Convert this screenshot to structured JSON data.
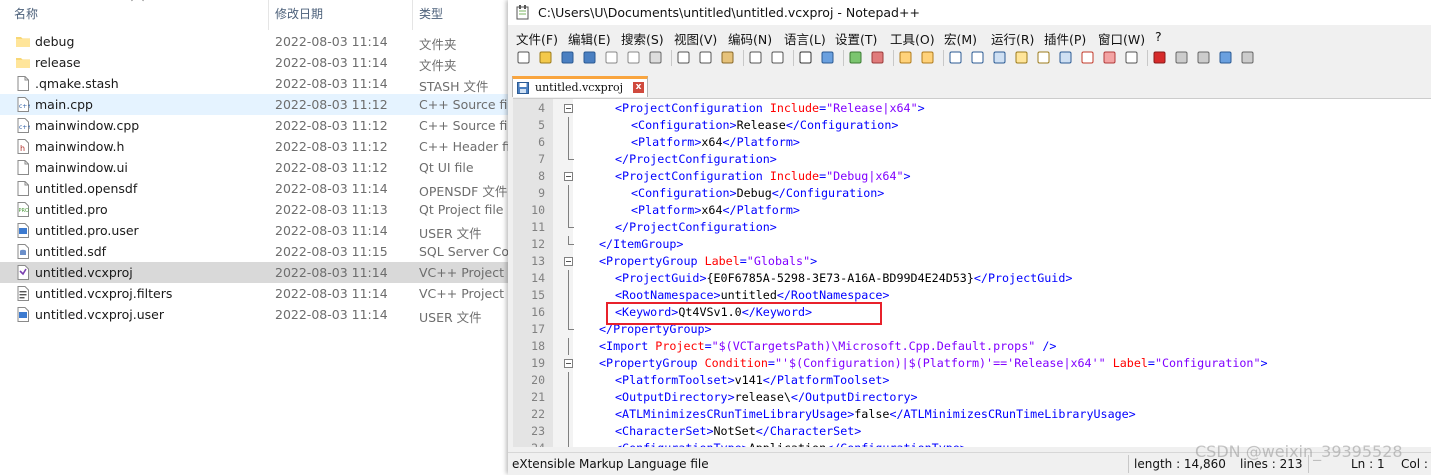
{
  "explorer": {
    "headers": {
      "name": "名称",
      "date": "修改日期",
      "type": "类型"
    },
    "files": [
      {
        "name": "debug",
        "date": "2022-08-03 11:14",
        "type": "文件夹",
        "icon": "folder-icon"
      },
      {
        "name": "release",
        "date": "2022-08-03 11:14",
        "type": "文件夹",
        "icon": "folder-icon"
      },
      {
        "name": ".qmake.stash",
        "date": "2022-08-03 11:14",
        "type": "STASH 文件",
        "icon": "file-icon"
      },
      {
        "name": "main.cpp",
        "date": "2022-08-03 11:12",
        "type": "C++ Source file",
        "icon": "cpp-file-icon"
      },
      {
        "name": "mainwindow.cpp",
        "date": "2022-08-03 11:12",
        "type": "C++ Source file",
        "icon": "cpp-file-icon"
      },
      {
        "name": "mainwindow.h",
        "date": "2022-08-03 11:12",
        "type": "C++ Header file",
        "icon": "header-file-icon"
      },
      {
        "name": "mainwindow.ui",
        "date": "2022-08-03 11:12",
        "type": "Qt UI file",
        "icon": "file-icon"
      },
      {
        "name": "untitled.opensdf",
        "date": "2022-08-03 11:14",
        "type": "OPENSDF 文件",
        "icon": "file-icon"
      },
      {
        "name": "untitled.pro",
        "date": "2022-08-03 11:13",
        "type": "Qt Project file",
        "icon": "pro-file-icon"
      },
      {
        "name": "untitled.pro.user",
        "date": "2022-08-03 11:14",
        "type": "USER 文件",
        "icon": "user-file-icon"
      },
      {
        "name": "untitled.sdf",
        "date": "2022-08-03 11:15",
        "type": "SQL Server Con",
        "icon": "database-file-icon"
      },
      {
        "name": "untitled.vcxproj",
        "date": "2022-08-03 11:14",
        "type": "VC++ Project",
        "icon": "vcxproj-file-icon"
      },
      {
        "name": "untitled.vcxproj.filters",
        "date": "2022-08-03 11:14",
        "type": "VC++ Project Fi",
        "icon": "filters-file-icon"
      },
      {
        "name": "untitled.vcxproj.user",
        "date": "2022-08-03 11:14",
        "type": "USER 文件",
        "icon": "user-file-icon"
      }
    ],
    "hovered_index": 3,
    "selected_index": 11
  },
  "npp": {
    "title": "C:\\Users\\U\\Documents\\untitled\\untitled.vcxproj - Notepad++",
    "menu": [
      "文件(F)",
      "编辑(E)",
      "搜索(S)",
      "视图(V)",
      "编码(N)",
      "语言(L)",
      "设置(T)",
      "工具(O)",
      "宏(M)",
      "运行(R)",
      "插件(P)",
      "窗口(W)",
      "?"
    ],
    "tab": {
      "label": "untitled.vcxproj",
      "close": "x"
    },
    "code_lines": [
      {
        "n": "4",
        "fold": "box",
        "indent": 2,
        "parts": [
          [
            "tag",
            "<ProjectConfiguration "
          ],
          [
            "attr",
            "Include"
          ],
          [
            "tag",
            "="
          ],
          [
            "val",
            "\"Release|x64\""
          ],
          [
            "tag",
            ">"
          ]
        ]
      },
      {
        "n": "5",
        "fold": "line",
        "indent": 3,
        "parts": [
          [
            "tag",
            "<Configuration>"
          ],
          [
            "txt",
            "Release"
          ],
          [
            "tag",
            "</Configuration>"
          ]
        ]
      },
      {
        "n": "6",
        "fold": "line",
        "indent": 3,
        "parts": [
          [
            "tag",
            "<Platform>"
          ],
          [
            "txt",
            "x64"
          ],
          [
            "tag",
            "</Platform>"
          ]
        ]
      },
      {
        "n": "7",
        "fold": "end",
        "indent": 2,
        "parts": [
          [
            "tag",
            "</ProjectConfiguration>"
          ]
        ]
      },
      {
        "n": "8",
        "fold": "box",
        "indent": 2,
        "parts": [
          [
            "tag",
            "<ProjectConfiguration "
          ],
          [
            "attr",
            "Include"
          ],
          [
            "tag",
            "="
          ],
          [
            "val",
            "\"Debug|x64\""
          ],
          [
            "tag",
            ">"
          ]
        ]
      },
      {
        "n": "9",
        "fold": "line",
        "indent": 3,
        "parts": [
          [
            "tag",
            "<Configuration>"
          ],
          [
            "txt",
            "Debug"
          ],
          [
            "tag",
            "</Configuration>"
          ]
        ]
      },
      {
        "n": "10",
        "fold": "line",
        "indent": 3,
        "parts": [
          [
            "tag",
            "<Platform>"
          ],
          [
            "txt",
            "x64"
          ],
          [
            "tag",
            "</Platform>"
          ]
        ]
      },
      {
        "n": "11",
        "fold": "end",
        "indent": 2,
        "parts": [
          [
            "tag",
            "</ProjectConfiguration>"
          ]
        ]
      },
      {
        "n": "12",
        "fold": "end",
        "indent": 1,
        "parts": [
          [
            "tag",
            "</ItemGroup>"
          ]
        ]
      },
      {
        "n": "13",
        "fold": "box",
        "indent": 1,
        "parts": [
          [
            "tag",
            "<PropertyGroup "
          ],
          [
            "attr",
            "Label"
          ],
          [
            "tag",
            "="
          ],
          [
            "val",
            "\"Globals\""
          ],
          [
            "tag",
            ">"
          ]
        ]
      },
      {
        "n": "14",
        "fold": "line",
        "indent": 2,
        "parts": [
          [
            "tag",
            "<ProjectGuid>"
          ],
          [
            "txt",
            "{E0F6785A-5298-3E73-A16A-BD99D4E24D53}"
          ],
          [
            "tag",
            "</ProjectGuid>"
          ]
        ]
      },
      {
        "n": "15",
        "fold": "line",
        "indent": 2,
        "parts": [
          [
            "tag",
            "<RootNamespace>"
          ],
          [
            "txt",
            "untitled"
          ],
          [
            "tag",
            "</RootNamespace>"
          ]
        ]
      },
      {
        "n": "16",
        "fold": "line",
        "indent": 2,
        "parts": [
          [
            "tag",
            "<Keyword>"
          ],
          [
            "txt",
            "Qt4VSv1.0"
          ],
          [
            "tag",
            "</Keyword>"
          ]
        ]
      },
      {
        "n": "17",
        "fold": "end",
        "indent": 1,
        "parts": [
          [
            "tag",
            "</PropertyGroup>"
          ]
        ]
      },
      {
        "n": "18",
        "fold": "line",
        "indent": 1,
        "parts": [
          [
            "tag",
            "<Import "
          ],
          [
            "attr",
            "Project"
          ],
          [
            "tag",
            "="
          ],
          [
            "val",
            "\"$(VCTargetsPath)\\Microsoft.Cpp.Default.props\""
          ],
          [
            "tag",
            " />"
          ]
        ]
      },
      {
        "n": "19",
        "fold": "box",
        "indent": 1,
        "parts": [
          [
            "tag",
            "<PropertyGroup "
          ],
          [
            "attr",
            "Condition"
          ],
          [
            "tag",
            "="
          ],
          [
            "val",
            "\"'$(Configuration)|$(Platform)'=='Release|x64'\""
          ],
          [
            "tag",
            " "
          ],
          [
            "attr",
            "Label"
          ],
          [
            "tag",
            "="
          ],
          [
            "val",
            "\"Configuration\""
          ],
          [
            "tag",
            ">"
          ]
        ]
      },
      {
        "n": "20",
        "fold": "line",
        "indent": 2,
        "parts": [
          [
            "tag",
            "<PlatformToolset>"
          ],
          [
            "txt",
            "v141"
          ],
          [
            "tag",
            "</PlatformToolset>"
          ]
        ]
      },
      {
        "n": "21",
        "fold": "line",
        "indent": 2,
        "parts": [
          [
            "tag",
            "<OutputDirectory>"
          ],
          [
            "txt",
            "release\\"
          ],
          [
            "tag",
            "</OutputDirectory>"
          ]
        ]
      },
      {
        "n": "22",
        "fold": "line",
        "indent": 2,
        "parts": [
          [
            "tag",
            "<ATLMinimizesCRunTimeLibraryUsage>"
          ],
          [
            "txt",
            "false"
          ],
          [
            "tag",
            "</ATLMinimizesCRunTimeLibraryUsage>"
          ]
        ]
      },
      {
        "n": "23",
        "fold": "line",
        "indent": 2,
        "parts": [
          [
            "tag",
            "<CharacterSet>"
          ],
          [
            "txt",
            "NotSet"
          ],
          [
            "tag",
            "</CharacterSet>"
          ]
        ]
      },
      {
        "n": "24",
        "fold": "line",
        "indent": 2,
        "parts": [
          [
            "tag",
            "<ConfigurationType>"
          ],
          [
            "txt",
            "Application"
          ],
          [
            "tag",
            "</ConfigurationType>"
          ]
        ]
      }
    ],
    "highlighted_line": "16",
    "status": {
      "file_type": "eXtensible Markup Language file",
      "length": "length : 14,860",
      "lines": "lines : 213",
      "ln": "Ln : 1",
      "col": "Col :"
    }
  },
  "watermark": "CSDN @weixin_39395528",
  "colors": {
    "tag": "#0000ff",
    "attr": "#ff0000",
    "value": "#8000ff",
    "highlight_border": "#e8212b",
    "tab_accent": "#f9a53f"
  }
}
